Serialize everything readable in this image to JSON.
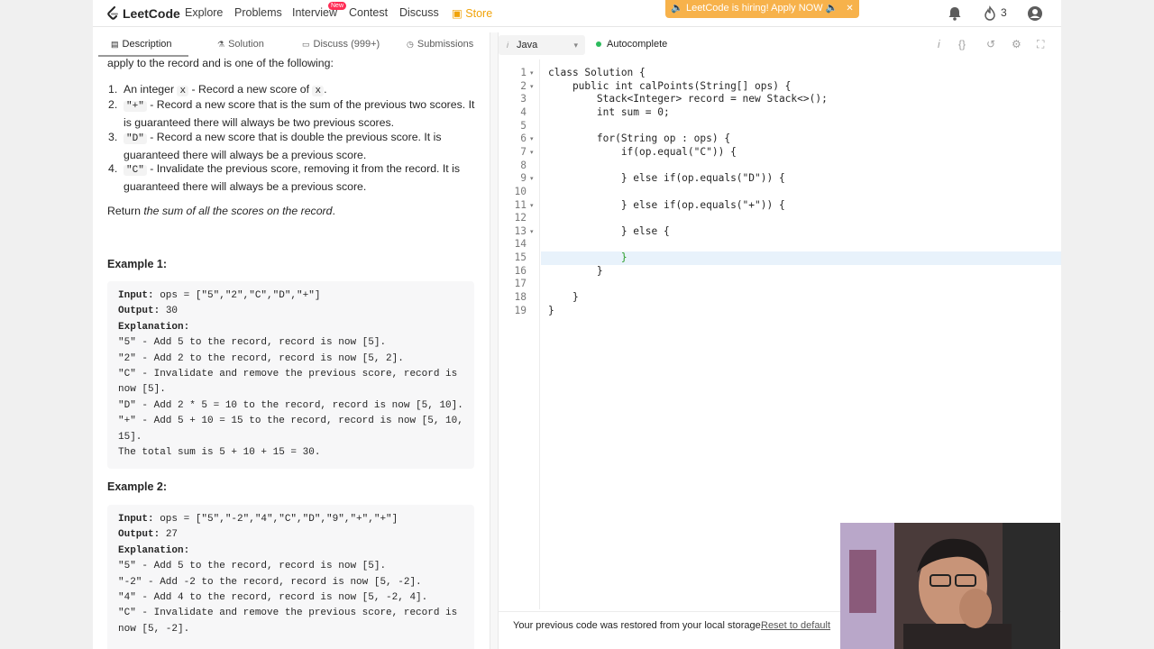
{
  "nav": {
    "brand": "LeetCode",
    "links": [
      "Explore",
      "Problems",
      "Interview",
      "Contest",
      "Discuss"
    ],
    "new_badge": "New",
    "store": "Store",
    "hiring_banner": "🔈 LeetCode is hiring! Apply NOW 🔈",
    "streak": "3"
  },
  "left_tabs": [
    "Description",
    "Solution",
    "Discuss (999+)",
    "Submissions"
  ],
  "description": {
    "intro": "apply to the record and is one of the following:",
    "items": [
      {
        "n": "1.",
        "pre": "An integer ",
        "code": "x",
        "post": " - Record a new score of ",
        "code2": "x",
        "post2": "."
      },
      {
        "n": "2.",
        "code": "\"+\"",
        "post": " - Record a new score that is the sum of the previous two scores. It is guaranteed there will always be two previous scores."
      },
      {
        "n": "3.",
        "code": "\"D\"",
        "post": " - Record a new score that is double the previous score. It is guaranteed there will always be a previous score."
      },
      {
        "n": "4.",
        "code": "\"C\"",
        "post": " - Invalidate the previous score, removing it from the record. It is guaranteed there will always be a previous score."
      }
    ],
    "return_pre": "Return ",
    "return_em": "the sum of all the scores on the record",
    "return_post": ".",
    "example1_label": "Example 1:",
    "example1": {
      "input_label": "Input:",
      "input": " ops = [\"5\",\"2\",\"C\",\"D\",\"+\"]",
      "output_label": "Output:",
      "output": " 30",
      "explanation_label": "Explanation:",
      "lines": [
        "\"5\" - Add 5 to the record, record is now [5].",
        "\"2\" - Add 2 to the record, record is now [5, 2].",
        "\"C\" - Invalidate and remove the previous score, record is now [5].",
        "\"D\" - Add 2 * 5 = 10 to the record, record is now [5, 10].",
        "\"+\" - Add 5 + 10 = 15 to the record, record is now [5, 10, 15].",
        "The total sum is 5 + 10 + 15 = 30."
      ]
    },
    "example2_label": "Example 2:",
    "example2": {
      "input_label": "Input:",
      "input": " ops = [\"5\",\"-2\",\"4\",\"C\",\"D\",\"9\",\"+\",\"+\"]",
      "output_label": "Output:",
      "output": " 27",
      "explanation_label": "Explanation:",
      "lines": [
        "\"5\" - Add 5 to the record, record is now [5].",
        "\"-2\" - Add -2 to the record, record is now [5, -2].",
        "\"4\" - Add 4 to the record, record is now [5, -2, 4].",
        "\"C\" - Invalidate and remove the previous score, record is now [5, -2]."
      ]
    }
  },
  "editor": {
    "language": "Java",
    "autocomplete": "Autocomplete",
    "lines": [
      "class Solution {",
      "    public int calPoints(String[] ops) {",
      "        Stack<Integer> record = new Stack<>();",
      "        int sum = 0;",
      "",
      "        for(String op : ops) {",
      "            if(op.equal(\"C\")) {",
      "",
      "            } else if(op.equals(\"D\")) {",
      "",
      "            } else if(op.equals(\"+\")) {",
      "",
      "            } else {",
      "",
      "            }",
      "        }",
      "",
      "    }",
      "}"
    ],
    "restore_msg": "Your previous code was restored from your local storage.",
    "reset_link": "Reset to default"
  }
}
